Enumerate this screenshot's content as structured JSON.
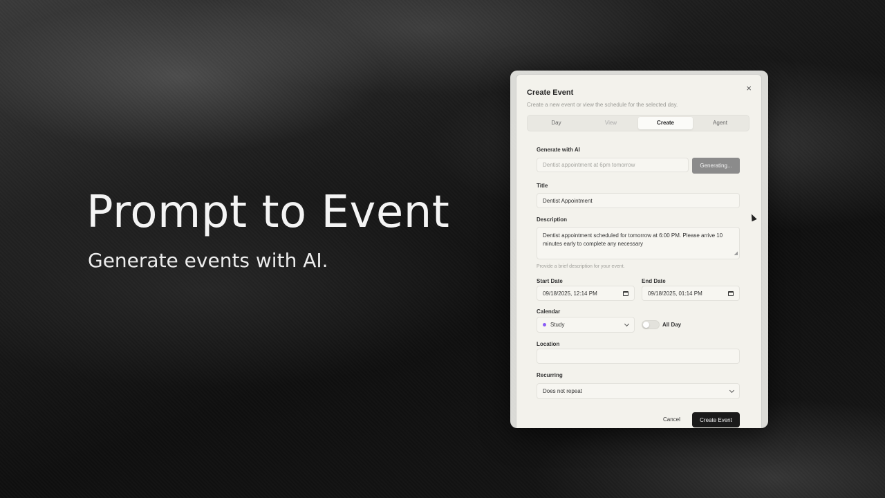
{
  "hero": {
    "title": "Prompt to Event",
    "subtitle": "Generate events with AI."
  },
  "dialog": {
    "title": "Create Event",
    "description": "Create a new event or view the schedule for the selected day.",
    "close_glyph": "×",
    "tabs": [
      {
        "label": "Day",
        "state": "normal"
      },
      {
        "label": "View",
        "state": "muted"
      },
      {
        "label": "Create",
        "state": "active"
      },
      {
        "label": "Agent",
        "state": "normal"
      }
    ],
    "ai": {
      "label": "Generate with AI",
      "placeholder": "Dentist appointment at 6pm tomorrow",
      "button": "Generating..."
    },
    "title_field": {
      "label": "Title",
      "value": "Dentist Appointment"
    },
    "description_field": {
      "label": "Description",
      "value": "Dentist appointment scheduled for tomorrow at 6:00 PM. Please arrive 10 minutes early to complete any necessary",
      "help": "Provide a brief description for your event."
    },
    "start_date": {
      "label": "Start Date",
      "value": "09/18/2025, 12:14 PM"
    },
    "end_date": {
      "label": "End Date",
      "value": "09/18/2025, 01:14 PM"
    },
    "calendar": {
      "label": "Calendar",
      "value": "Study",
      "color": "#8b5cf6"
    },
    "all_day": {
      "label": "All Day",
      "on": false
    },
    "location": {
      "label": "Location",
      "value": ""
    },
    "recurring": {
      "label": "Recurring",
      "value": "Does not repeat"
    },
    "actions": {
      "cancel": "Cancel",
      "create": "Create Event"
    }
  }
}
